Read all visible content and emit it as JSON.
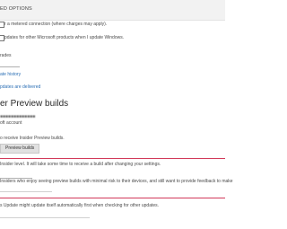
{
  "header": {
    "title": "ED OPTIONS"
  },
  "options": {
    "metered_text": "r a metered connection (where charges may apply).",
    "ms_products_text": "pdates for other Microsoft products when I update Windows.",
    "upgrades_text": "rades",
    "history_link": "ate history",
    "delivery_link": "pdates are delivered"
  },
  "insider": {
    "section_title": "er Preview builds",
    "account_text": "oft account",
    "receive_text": "o receive Insider Preview builds.",
    "preview_button": "Preview builds",
    "level_text": "Insider level. It will take some time to receive a build after changing your settings.",
    "description_text": "Insiders who enjoy seeing preview builds with minimal risk to their devices, and still want to provide feedback to make"
  },
  "footer": {
    "note": "s Update might update itself automatically first when checking for other updates."
  },
  "colors": {
    "accent_link": "#2b6fb5",
    "highlight_line": "#d23a5a",
    "header_bg": "#f2f2f2"
  }
}
